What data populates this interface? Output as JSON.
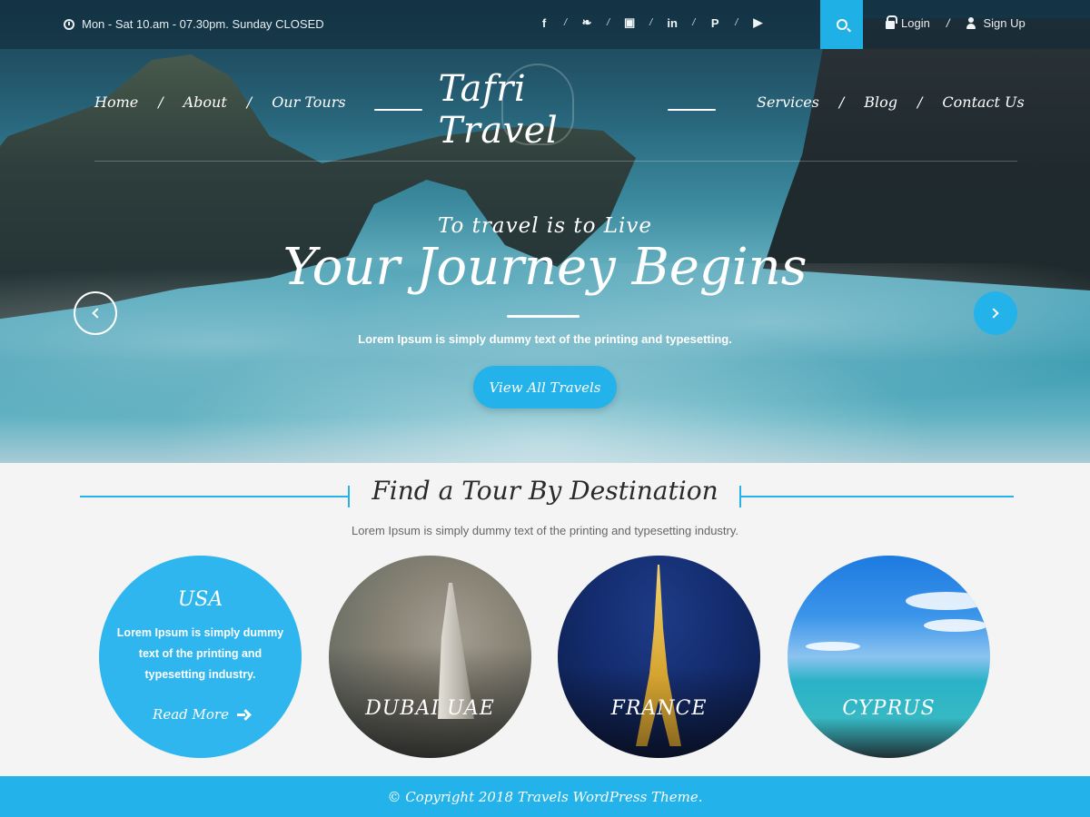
{
  "topbar": {
    "hours": "Mon - Sat 10.am - 07.30pm. Sunday CLOSED",
    "social": [
      {
        "icon": "facebook-icon",
        "glyph": "f"
      },
      {
        "icon": "twitter-icon",
        "glyph": "❧"
      },
      {
        "icon": "instagram-icon",
        "glyph": "▣"
      },
      {
        "icon": "linkedin-icon",
        "glyph": "in"
      },
      {
        "icon": "pinterest-icon",
        "glyph": "P"
      },
      {
        "icon": "youtube-icon",
        "glyph": "▶"
      }
    ],
    "separator": "/",
    "login_label": "Login",
    "signup_label": "Sign Up"
  },
  "nav": {
    "left": [
      "Home",
      "About",
      "Our Tours"
    ],
    "right": [
      "Services",
      "Blog",
      "Contact Us"
    ],
    "separator": "/",
    "brand": "Tafri Travel"
  },
  "hero": {
    "tagline": "To travel is to Live",
    "headline": "Your Journey Begins",
    "subtext": "Lorem Ipsum is simply dummy text of the printing and typesetting.",
    "cta_label": "View All Travels"
  },
  "destinations": {
    "title": "Find a Tour By Destination",
    "subtitle": "Lorem Ipsum is simply dummy text of the printing and typesetting industry.",
    "featured": {
      "name": "USA",
      "text": "Lorem Ipsum is simply dummy text of the printing and typesetting industry.",
      "read_more": "Read More"
    },
    "items": [
      "DUBAI UAE",
      "FRANCE",
      "CYPRUS"
    ]
  },
  "footer": {
    "copyright": "© Copyright 2018 Travels WordPress Theme."
  },
  "colors": {
    "accent": "#23b3ea",
    "footer_bg": "#23b3ea"
  }
}
